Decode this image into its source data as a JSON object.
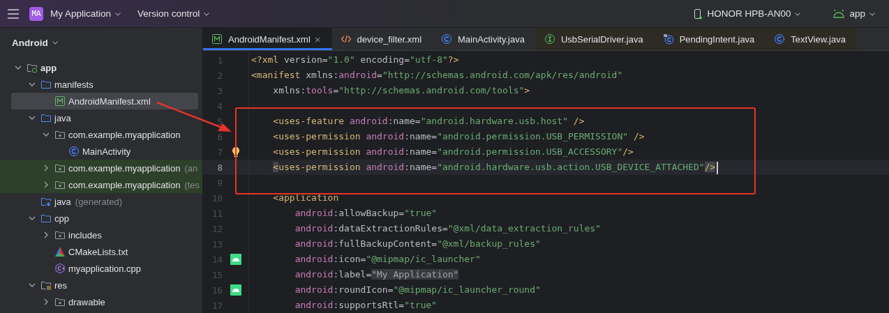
{
  "top_bar": {
    "project_badge": "MA",
    "project": "My Application",
    "vcs": "Version control",
    "device": "HONOR HPB-AN00",
    "device_online": true,
    "run_config": "app"
  },
  "project_panel": {
    "title": "Android",
    "tree": [
      {
        "label": "app",
        "kind": "module",
        "expanded": true,
        "selected": false,
        "children": [
          {
            "label": "manifests",
            "kind": "folder",
            "expanded": true,
            "selected": false,
            "children": [
              {
                "label": "AndroidManifest.xml",
                "kind": "manifest",
                "selected": true
              }
            ]
          },
          {
            "label": "java",
            "kind": "folder",
            "expanded": true,
            "selected": false,
            "children": [
              {
                "label": "com.example.myapplication",
                "kind": "package",
                "expanded": true,
                "selected": false,
                "children": [
                  {
                    "label": "MainActivity",
                    "kind": "class",
                    "selected": false
                  }
                ]
              },
              {
                "label": "com.example.myapplication",
                "suffix": "(an",
                "kind": "package",
                "expanded": false,
                "test_source": true,
                "selected": false
              },
              {
                "label": "com.example.myapplication",
                "suffix": "(tes",
                "kind": "package",
                "expanded": false,
                "test_source": true,
                "selected": false
              }
            ]
          },
          {
            "label": "java",
            "suffix": "(generated)",
            "kind": "generated",
            "selected": false
          },
          {
            "label": "cpp",
            "kind": "folder",
            "expanded": true,
            "selected": false,
            "children": [
              {
                "label": "includes",
                "kind": "package",
                "expanded": false,
                "selected": false
              },
              {
                "label": "CMakeLists.txt",
                "kind": "cmake",
                "selected": false
              },
              {
                "label": "myapplication.cpp",
                "kind": "cpp",
                "selected": false
              }
            ]
          },
          {
            "label": "res",
            "kind": "res",
            "expanded": true,
            "selected": false,
            "children": [
              {
                "label": "drawable",
                "kind": "package",
                "expanded": false,
                "selected": false
              }
            ]
          }
        ]
      }
    ]
  },
  "tabs": [
    {
      "label": "AndroidManifest.xml",
      "kind": "manifest",
      "selected": true,
      "library": false,
      "close": "×"
    },
    {
      "label": "device_filter.xml",
      "kind": "xml",
      "selected": false,
      "library": false
    },
    {
      "label": "MainActivity.java",
      "kind": "class",
      "selected": false,
      "library": false
    },
    {
      "label": "UsbSerialDriver.java",
      "kind": "interface",
      "selected": false,
      "library": true
    },
    {
      "label": "PendingIntent.java",
      "kind": "class-locked",
      "selected": false,
      "library": true
    },
    {
      "label": "TextView.java",
      "kind": "class",
      "selected": false,
      "library": true
    }
  ],
  "editor": {
    "lines": [
      {
        "number": "1",
        "current": false,
        "tokens": [
          {
            "kind": "tag",
            "text": "<?xml"
          },
          {
            "kind": "plain",
            "text": " version="
          },
          {
            "kind": "string",
            "text": "\"1.0\""
          },
          {
            "kind": "plain",
            "text": " encoding="
          },
          {
            "kind": "string",
            "text": "\"utf-8\""
          },
          {
            "kind": "tag",
            "text": "?>"
          }
        ]
      },
      {
        "number": "2",
        "current": false,
        "tokens": [
          {
            "kind": "tag",
            "text": "<manifest"
          },
          {
            "kind": "plain",
            "text": " xmlns:"
          },
          {
            "kind": "ns",
            "text": "android"
          },
          {
            "kind": "plain",
            "text": "="
          },
          {
            "kind": "string",
            "text": "\"http://schemas.android.com/apk/res/android\""
          }
        ]
      },
      {
        "number": "3",
        "current": false,
        "tokens": [
          {
            "kind": "plain",
            "text": "    xmlns:"
          },
          {
            "kind": "ns",
            "text": "tools"
          },
          {
            "kind": "plain",
            "text": "="
          },
          {
            "kind": "string",
            "text": "\"http://schemas.android.com/tools\""
          },
          {
            "kind": "tag",
            "text": ">"
          }
        ]
      },
      {
        "number": "4",
        "current": false
      },
      {
        "number": "5",
        "current": false,
        "tokens": [
          {
            "kind": "tag",
            "text": "    <uses-feature"
          },
          {
            "kind": "ns",
            "text": " android"
          },
          {
            "kind": "plain",
            "text": ":name="
          },
          {
            "kind": "string",
            "text": "\"android.hardware.usb.host\""
          },
          {
            "kind": "tag",
            "text": " />"
          }
        ]
      },
      {
        "number": "6",
        "current": false,
        "tokens": [
          {
            "kind": "tag",
            "text": "    <uses-permission"
          },
          {
            "kind": "ns",
            "text": " android"
          },
          {
            "kind": "plain",
            "text": ":name="
          },
          {
            "kind": "string",
            "text": "\"android.permission.USB_PERMISSION\""
          },
          {
            "kind": "tag",
            "text": " />"
          }
        ]
      },
      {
        "number": "7",
        "current": false,
        "gutter": {
          "kind": "bulb"
        },
        "tokens": [
          {
            "kind": "tag",
            "text": "    <uses-permission"
          },
          {
            "kind": "ns",
            "text": " android"
          },
          {
            "kind": "plain",
            "text": ":name="
          },
          {
            "kind": "string",
            "text": "\"android.permission.USB_ACCESSORY\""
          },
          {
            "kind": "tag",
            "text": "/>"
          }
        ]
      },
      {
        "number": "8",
        "current": true,
        "tokens": [
          {
            "kind": "tag-match",
            "text": "    <"
          },
          {
            "kind": "tag",
            "text": "uses-permission"
          },
          {
            "kind": "ns",
            "text": " android"
          },
          {
            "kind": "plain",
            "text": ":name="
          },
          {
            "kind": "string",
            "text": "\"android.hardware.usb.action.USB_DEVICE_ATTACHED\""
          },
          {
            "kind": "tag-match",
            "text": "/>"
          }
        ]
      },
      {
        "number": "9",
        "current": false
      },
      {
        "number": "10",
        "current": false,
        "tokens": [
          {
            "kind": "tag",
            "text": "    <application"
          }
        ]
      },
      {
        "number": "11",
        "current": false,
        "tokens": [
          {
            "kind": "ns",
            "text": "        android"
          },
          {
            "kind": "plain",
            "text": ":allowBackup="
          },
          {
            "kind": "string",
            "text": "\"true\""
          }
        ]
      },
      {
        "number": "12",
        "current": false,
        "tokens": [
          {
            "kind": "ns",
            "text": "        android"
          },
          {
            "kind": "plain",
            "text": ":dataExtractionRules="
          },
          {
            "kind": "string",
            "text": "\"@xml/data_extraction_rules\""
          }
        ]
      },
      {
        "number": "13",
        "current": false,
        "tokens": [
          {
            "kind": "ns",
            "text": "        android"
          },
          {
            "kind": "plain",
            "text": ":fullBackupContent="
          },
          {
            "kind": "string",
            "text": "\"@xml/backup_rules\""
          }
        ]
      },
      {
        "number": "14",
        "current": false,
        "gutter": {
          "kind": "android"
        },
        "tokens": [
          {
            "kind": "ns",
            "text": "        android"
          },
          {
            "kind": "plain",
            "text": ":icon="
          },
          {
            "kind": "string",
            "text": "\"@mipmap/ic_launcher\""
          }
        ]
      },
      {
        "number": "15",
        "current": false,
        "tokens": [
          {
            "kind": "ns",
            "text": "        android"
          },
          {
            "kind": "plain",
            "text": ":label="
          },
          {
            "kind": "folded",
            "text": "\"My Application\""
          }
        ]
      },
      {
        "number": "16",
        "current": false,
        "gutter": {
          "kind": "android"
        },
        "tokens": [
          {
            "kind": "ns",
            "text": "        android"
          },
          {
            "kind": "plain",
            "text": ":roundIcon="
          },
          {
            "kind": "string",
            "text": "\"@mipmap/ic_launcher_round\""
          }
        ]
      },
      {
        "number": "17",
        "current": false,
        "tokens": [
          {
            "kind": "ns",
            "text": "        android"
          },
          {
            "kind": "plain",
            "text": ":supportsRtl="
          },
          {
            "kind": "string",
            "text": "\"true\""
          }
        ]
      }
    ]
  }
}
